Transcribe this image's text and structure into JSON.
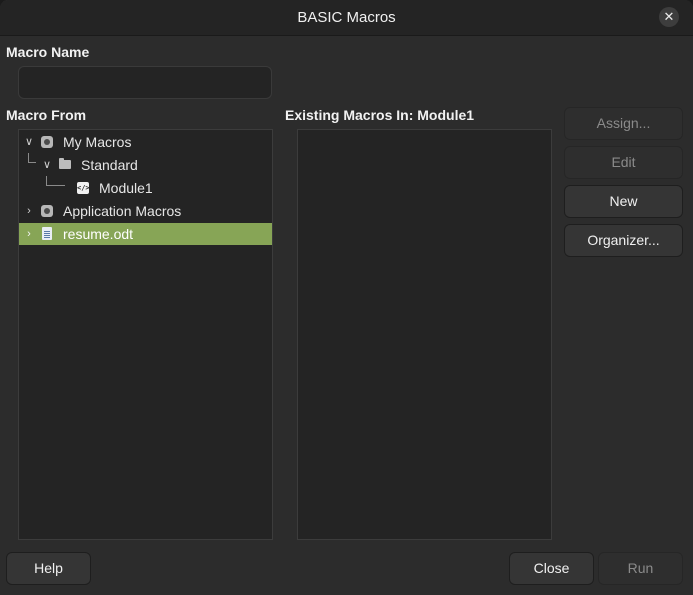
{
  "window": {
    "title": "BASIC Macros",
    "close_glyph": "✕"
  },
  "macro_name": {
    "label": "Macro Name",
    "value": "",
    "placeholder": ""
  },
  "macro_from": {
    "label": "Macro From",
    "tree": [
      {
        "label": "My Macros",
        "icon": "library-icon",
        "expanded": true
      },
      {
        "label": "Standard",
        "icon": "folder-icon",
        "expanded": true
      },
      {
        "label": "Module1",
        "icon": "code-module-icon"
      },
      {
        "label": "Application Macros",
        "icon": "library-icon",
        "expanded": false
      },
      {
        "label": "resume.odt",
        "icon": "document-icon",
        "expanded": false,
        "selected": true
      }
    ]
  },
  "existing": {
    "label": "Existing Macros In: Module1"
  },
  "buttons": {
    "assign": "Assign...",
    "edit": "Edit",
    "new": "New",
    "organizer": "Organizer...",
    "help": "Help",
    "close": "Close",
    "run": "Run"
  },
  "colors": {
    "selection": "#87a556",
    "background": "#2c2c2c"
  }
}
